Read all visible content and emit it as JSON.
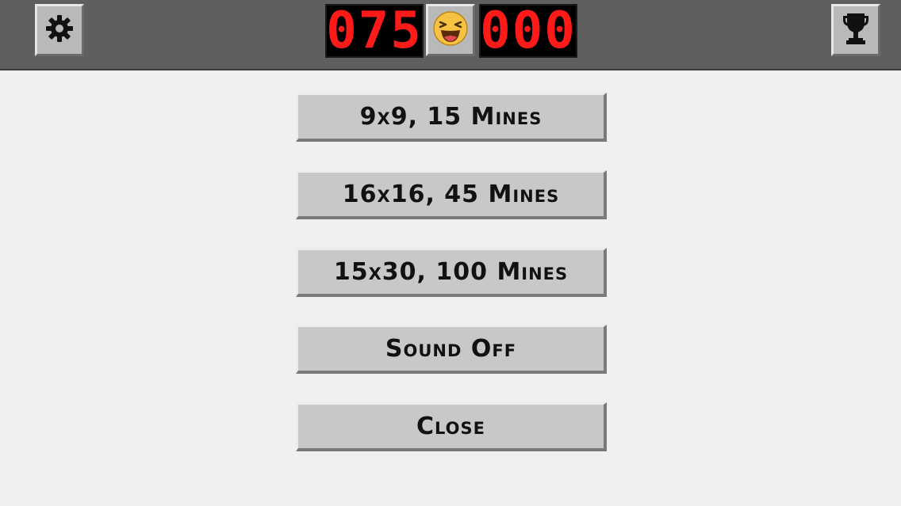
{
  "header": {
    "mine_counter": "075",
    "timer": "000",
    "face_icon": "laughing-face-icon",
    "settings_icon": "gear-icon",
    "trophy_icon": "trophy-icon"
  },
  "menu": {
    "items": [
      {
        "label": "9x9, 15 Mines"
      },
      {
        "label": "16x16, 45 Mines"
      },
      {
        "label": "15x30, 100 Mines"
      },
      {
        "label": "Sound Off"
      },
      {
        "label": "Close"
      }
    ]
  },
  "colors": {
    "topbar": "#5f5f5f",
    "lcd_digits": "#ff1a1a",
    "button_face": "#c8c8c8",
    "background": "#f0f0f0"
  }
}
